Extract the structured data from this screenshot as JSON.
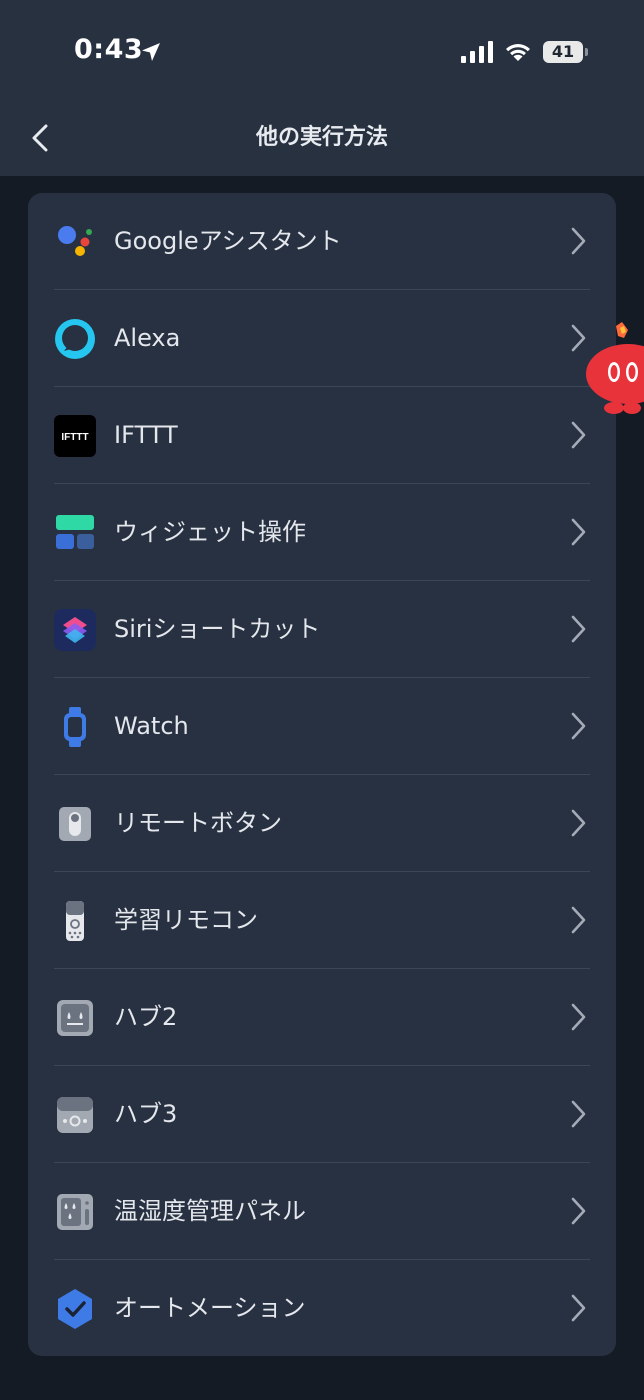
{
  "status_bar": {
    "time": "0:43",
    "battery": "41"
  },
  "header": {
    "title": "他の実行方法"
  },
  "items": [
    {
      "label": "Googleアシスタント",
      "icon": "google-assistant-icon"
    },
    {
      "label": "Alexa",
      "icon": "alexa-icon"
    },
    {
      "label": "IFTTT",
      "icon": "ifttt-icon",
      "icon_text": "IFTTT"
    },
    {
      "label": "ウィジェット操作",
      "icon": "widget-icon"
    },
    {
      "label": "Siriショートカット",
      "icon": "siri-shortcuts-icon"
    },
    {
      "label": "Watch",
      "icon": "watch-icon"
    },
    {
      "label": "リモートボタン",
      "icon": "remote-button-icon"
    },
    {
      "label": "学習リモコン",
      "icon": "learning-remote-icon"
    },
    {
      "label": "ハブ2",
      "icon": "hub2-icon"
    },
    {
      "label": "ハブ3",
      "icon": "hub3-icon"
    },
    {
      "label": "温湿度管理パネル",
      "icon": "climate-panel-icon"
    },
    {
      "label": "オートメーション",
      "icon": "automation-icon"
    }
  ],
  "colors": {
    "background": "#151b25",
    "header_bg": "#283140",
    "card_bg": "#283141",
    "text": "#e4e7ec",
    "chevron": "#a4abb7"
  }
}
